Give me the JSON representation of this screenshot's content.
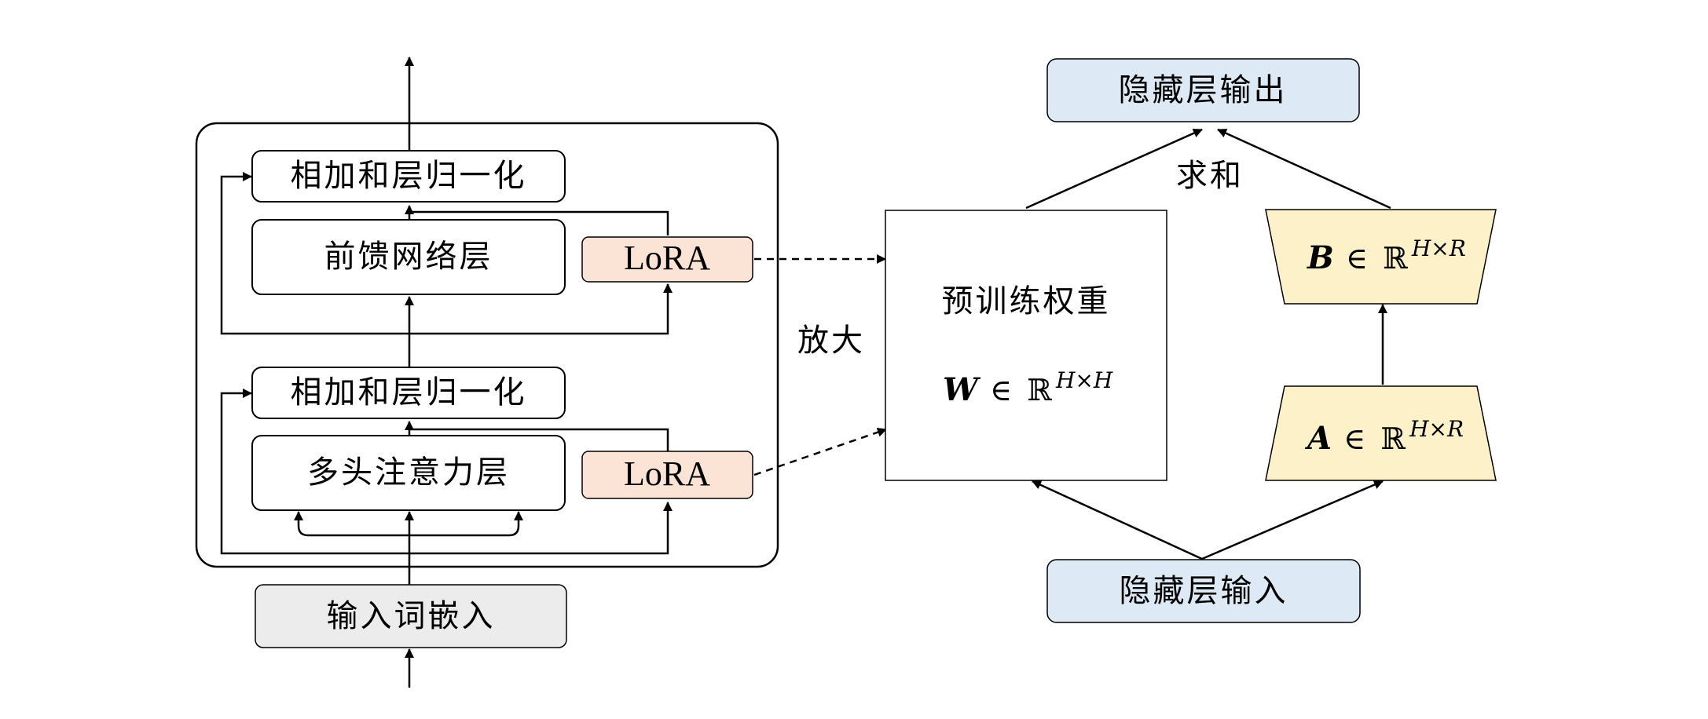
{
  "encoder": {
    "add_norm_top": "相加和层归一化",
    "ffn": "前馈网络层",
    "add_norm_bottom": "相加和层归一化",
    "mha": "多头注意力层",
    "lora_top": "LoRA",
    "lora_bottom": "LoRA",
    "input_embedding": "输入词嵌入"
  },
  "lora_panel": {
    "hidden_output": "隐藏层输出",
    "hidden_input": "隐藏层输入",
    "sum_label": "求和",
    "zoom_label": "放大",
    "pretrained_title": "预训练权重",
    "w_symbol": "W",
    "w_in": "∈",
    "w_space": "ℝ",
    "w_dims": "H×H",
    "b_symbol": "B",
    "b_in": "∈",
    "b_space": "ℝ",
    "b_dims": "H×R",
    "a_symbol": "A",
    "a_in": "∈",
    "a_space": "ℝ",
    "a_dims": "H×R"
  },
  "colors": {
    "lora_fill": "#fbe3d5",
    "hidden_fill": "#dde9f5",
    "matrix_fill": "#fdf1c9",
    "embedding_fill": "#ececec",
    "stroke": "#000000"
  }
}
